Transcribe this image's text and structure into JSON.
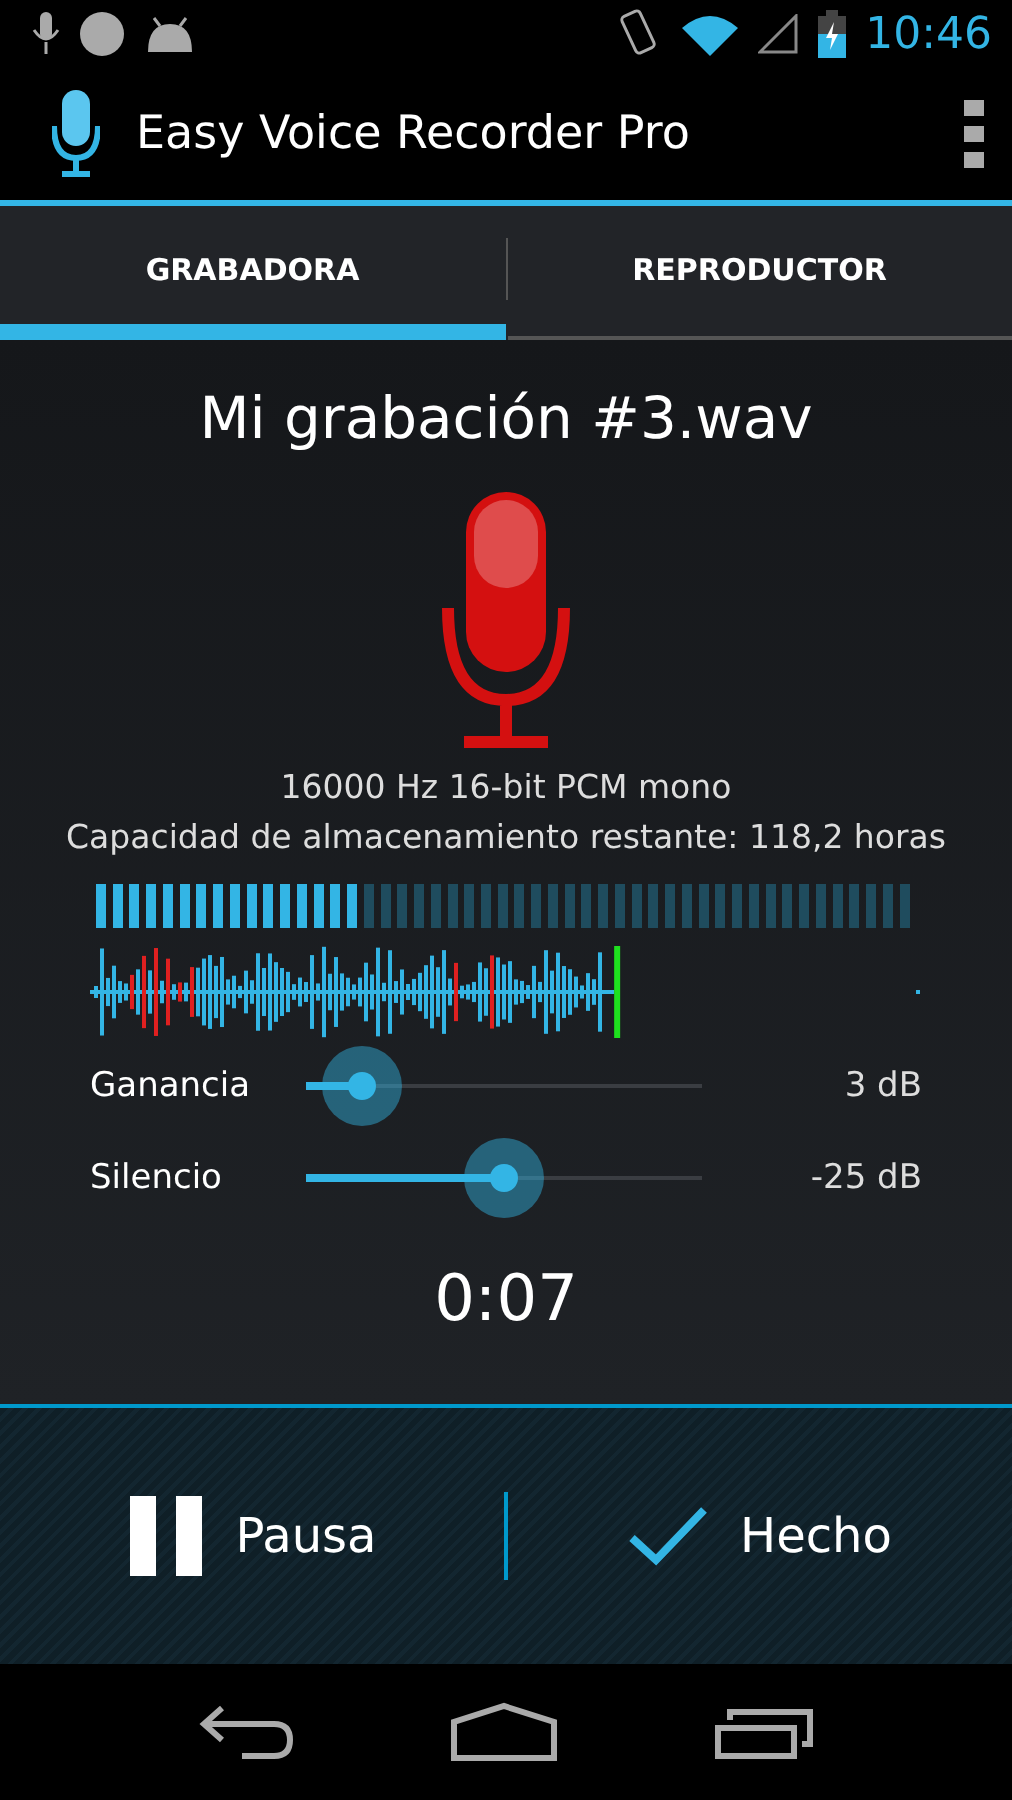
{
  "status_bar": {
    "time": "10:46"
  },
  "app_bar": {
    "title": "Easy Voice Recorder Pro"
  },
  "tabs": [
    {
      "label": "GRABADORA",
      "selected": true
    },
    {
      "label": "REPRODUCTOR",
      "selected": false
    }
  ],
  "recording": {
    "file_name": "Mi grabación #3.wav",
    "recording": true,
    "format": "16000 Hz 16-bit PCM mono",
    "storage": "Capacidad de almacenamiento restante: 118,2 horas",
    "meter": {
      "level": 0.33
    }
  },
  "sliders": [
    {
      "label": "Ganancia",
      "level": 0.14,
      "reading": "3 dB"
    },
    {
      "label": "Silencio",
      "level": 0.5,
      "reading": "-25 dB"
    }
  ],
  "timer": "0:07",
  "actions": [
    {
      "kind": "pause",
      "label": "Pausa"
    },
    {
      "kind": "done",
      "label": "Hecho"
    }
  ]
}
